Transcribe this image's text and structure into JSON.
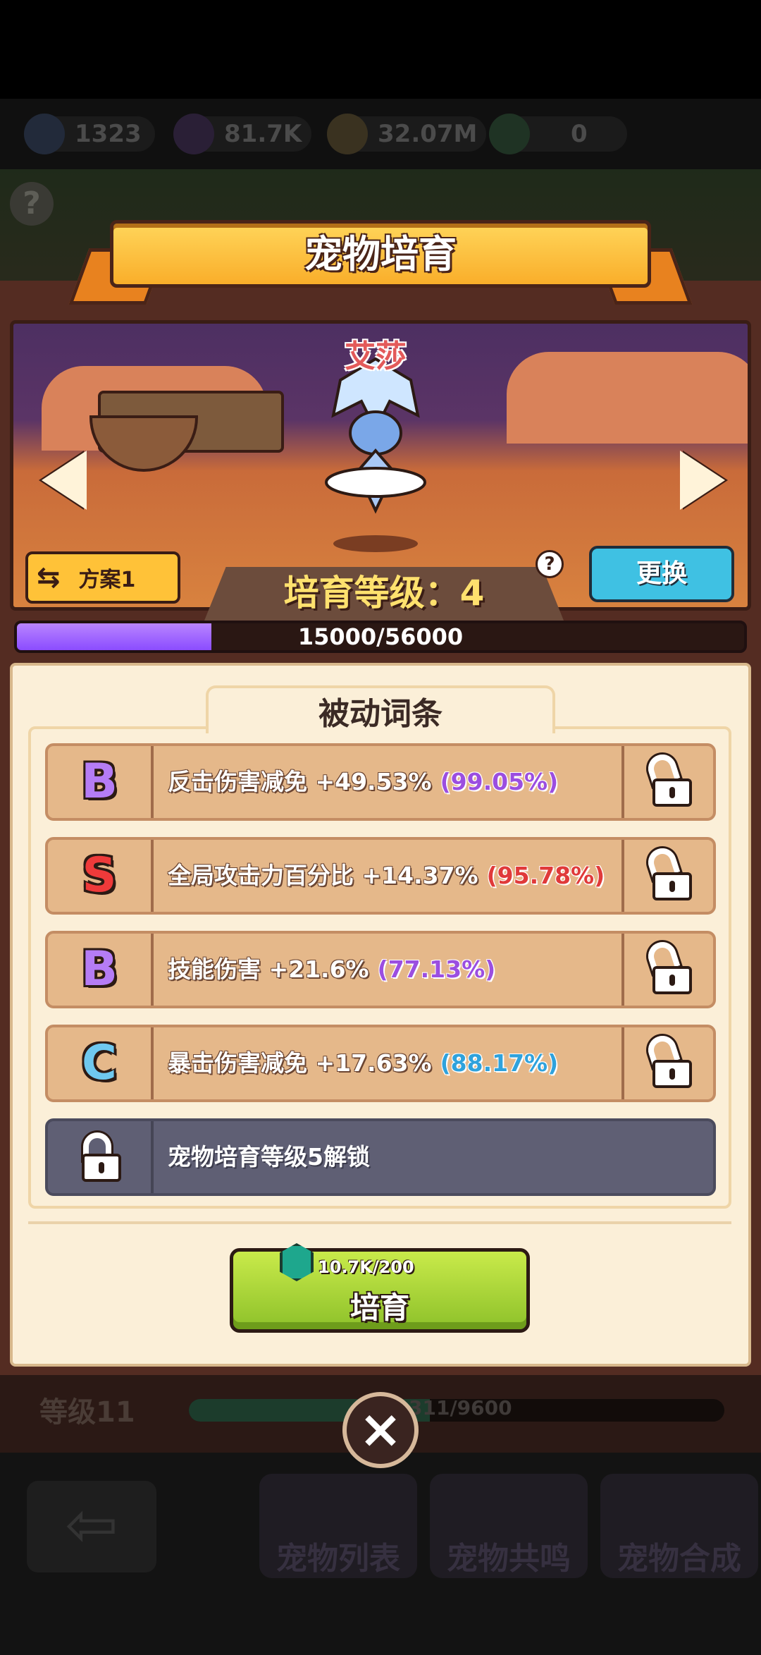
{
  "resources": [
    {
      "icon": "helmet-icon",
      "value": "1323"
    },
    {
      "icon": "purple-gem-icon",
      "value": "81.7K"
    },
    {
      "icon": "gold-coin-icon",
      "value": "32.07M"
    },
    {
      "icon": "green-shard-icon",
      "value": "0"
    }
  ],
  "dialog": {
    "title": "宠物培育",
    "pet_name": "艾莎",
    "plan_label": "方案1",
    "swap_label": "更换",
    "grade_label": "培育等级：4",
    "xp": {
      "current": 15000,
      "max": 56000,
      "text": "15000/56000"
    }
  },
  "passives": {
    "title": "被动词条",
    "affixes": [
      {
        "grade": "B",
        "grade_color": "#b57cf5",
        "text": "反击伤害减免 +49.53%",
        "pct": "(99.05%)",
        "pct_color": "#9b4ee0",
        "locked": false
      },
      {
        "grade": "S",
        "grade_color": "#ef3a3a",
        "text": "全局攻击力百分比 +14.37%",
        "pct": "(95.78%)",
        "pct_color": "#e03a3a",
        "locked": false
      },
      {
        "grade": "B",
        "grade_color": "#b57cf5",
        "text": "技能伤害 +21.6%",
        "pct": "(77.13%)",
        "pct_color": "#9b4ee0",
        "locked": false
      },
      {
        "grade": "C",
        "grade_color": "#6fc8ef",
        "text": "暴击伤害减免 +17.63%",
        "pct": "(88.17%)",
        "pct_color": "#2fa2dc",
        "locked": false
      }
    ],
    "locked_slot": {
      "text": "宠物培育等级5解锁"
    }
  },
  "breed_button": {
    "cost": "10.7K/200",
    "label": "培育"
  },
  "background": {
    "level_label": "等级11",
    "level_progress_text": "311/9600",
    "tabs": [
      "宠物列表",
      "宠物共鸣",
      "宠物合成"
    ]
  }
}
